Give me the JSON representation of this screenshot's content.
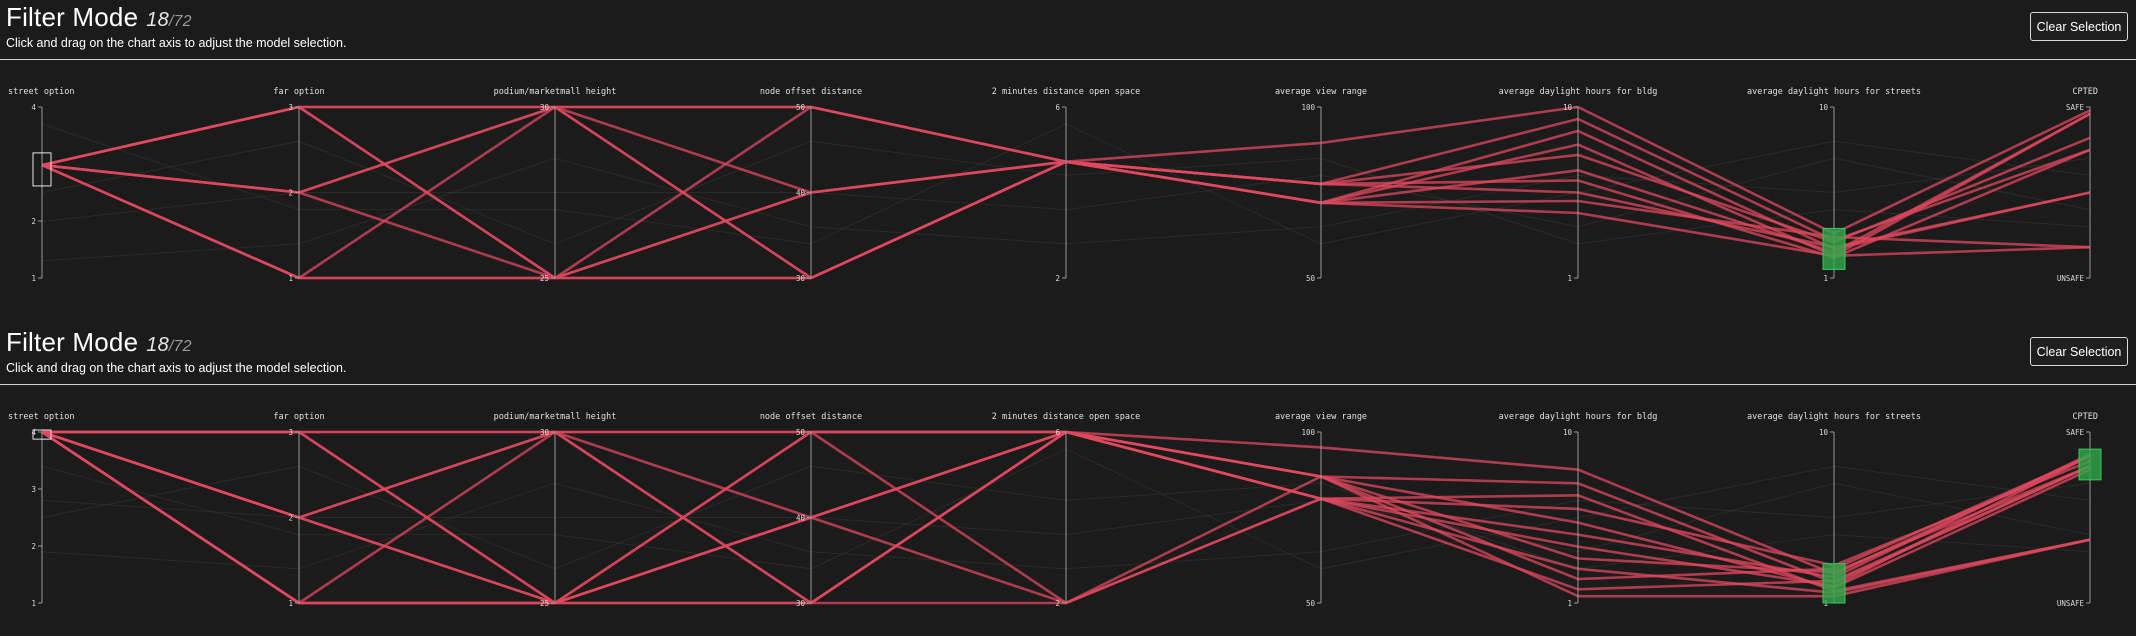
{
  "panels": [
    {
      "title": "Filter Mode",
      "count": "18",
      "total": "/72",
      "hint": "Click and drag on the chart axis to adjust the model selection.",
      "clear_label": "Clear Selection"
    },
    {
      "title": "Filter Mode",
      "count": "18",
      "total": "/72",
      "hint": "Click and drag on the chart axis to adjust the model selection.",
      "clear_label": "Clear Selection"
    }
  ],
  "colors": {
    "background": "#1b1b1b",
    "selected_line": "#e0485f",
    "context_line": "#3a3a3a",
    "brush": "#2faa4b"
  },
  "chart_data": [
    {
      "type": "parallel-coordinates",
      "axes": [
        {
          "label": "street option",
          "top": "4",
          "mid": [
            "",
            "2"
          ],
          "bottom": "1"
        },
        {
          "label": "far option",
          "top": "3",
          "mid": [
            "2"
          ],
          "bottom": "1"
        },
        {
          "label": "podium/marketmall height",
          "top": "30",
          "mid": [],
          "bottom": "25"
        },
        {
          "label": "node offset distance",
          "top": "50",
          "mid": [
            "40"
          ],
          "bottom": "30"
        },
        {
          "label": "2 minutes distance open space",
          "top": "6",
          "mid": [],
          "bottom": "2"
        },
        {
          "label": "average view range",
          "top": "100",
          "mid": [],
          "bottom": "50"
        },
        {
          "label": "average daylight hours for bldg",
          "top": "10",
          "mid": [],
          "bottom": "1"
        },
        {
          "label": "average daylight hours for streets",
          "top": "10",
          "mid": [],
          "bottom": "1"
        },
        {
          "label": "CPTED",
          "top": "SAFE",
          "mid": [],
          "bottom": "UNSAFE"
        }
      ],
      "lines": [
        [
          0.66,
          1.0,
          1.0,
          1.0,
          0.68,
          0.79,
          1.0,
          0.26,
          0.98
        ],
        [
          0.66,
          1.0,
          1.0,
          0.5,
          0.68,
          0.55,
          0.93,
          0.22,
          0.75
        ],
        [
          0.66,
          0.5,
          0.0,
          0.0,
          0.68,
          0.44,
          0.86,
          0.17,
          0.5
        ],
        [
          0.66,
          0.0,
          0.0,
          0.5,
          0.68,
          0.44,
          0.78,
          0.13,
          0.18
        ],
        [
          0.66,
          0.5,
          1.0,
          0.0,
          0.68,
          0.55,
          0.72,
          0.21,
          0.82
        ],
        [
          0.66,
          1.0,
          0.0,
          1.0,
          0.68,
          0.44,
          0.63,
          0.15,
          0.96
        ],
        [
          0.66,
          0.0,
          1.0,
          0.0,
          0.68,
          0.55,
          0.57,
          0.12,
          0.75
        ],
        [
          0.66,
          0.5,
          1.0,
          1.0,
          0.68,
          0.55,
          0.5,
          0.18,
          0.5
        ],
        [
          0.66,
          0.0,
          0.0,
          0.0,
          0.68,
          0.44,
          0.45,
          0.24,
          0.18
        ],
        [
          0.66,
          1.0,
          0.0,
          0.5,
          0.68,
          0.44,
          0.38,
          0.13,
          0.96
        ]
      ],
      "context_lines": [
        [
          0.33,
          0.5,
          0.5,
          0.5,
          0.4,
          0.6,
          0.3,
          0.7,
          0.4
        ],
        [
          0.1,
          0.2,
          0.7,
          0.3,
          0.2,
          0.3,
          0.6,
          0.5,
          0.7
        ],
        [
          0.5,
          0.8,
          0.2,
          0.8,
          0.6,
          0.7,
          0.2,
          0.4,
          0.3
        ],
        [
          0.9,
          0.4,
          0.4,
          0.2,
          0.9,
          0.2,
          0.5,
          0.8,
          0.6
        ]
      ],
      "brushes": [
        {
          "axis": 0,
          "range": [
            0.55,
            0.72
          ],
          "style": "outline"
        },
        {
          "axis": 7,
          "range": [
            0.05,
            0.29
          ],
          "style": "filled"
        }
      ]
    },
    {
      "type": "parallel-coordinates",
      "axes": [
        {
          "label": "street option",
          "top": "4",
          "mid": [
            "3",
            "2"
          ],
          "bottom": "1"
        },
        {
          "label": "far option",
          "top": "3",
          "mid": [
            "2"
          ],
          "bottom": "1"
        },
        {
          "label": "podium/marketmall height",
          "top": "30",
          "mid": [],
          "bottom": "25"
        },
        {
          "label": "node offset distance",
          "top": "50",
          "mid": [
            "40"
          ],
          "bottom": "30"
        },
        {
          "label": "2 minutes distance open space",
          "top": "6",
          "mid": [],
          "bottom": "2"
        },
        {
          "label": "average view range",
          "top": "100",
          "mid": [],
          "bottom": "50"
        },
        {
          "label": "average daylight hours for bldg",
          "top": "10",
          "mid": [],
          "bottom": "1"
        },
        {
          "label": "average daylight hours for streets",
          "top": "10",
          "mid": [],
          "bottom": "1"
        },
        {
          "label": "CPTED",
          "top": "SAFE",
          "mid": [],
          "bottom": "UNSAFE"
        }
      ],
      "lines": [
        [
          1.0,
          1.0,
          1.0,
          1.0,
          1.0,
          0.91,
          0.78,
          0.17,
          0.86
        ],
        [
          1.0,
          0.5,
          0.0,
          0.5,
          1.0,
          0.74,
          0.7,
          0.12,
          0.8
        ],
        [
          1.0,
          0.0,
          0.0,
          0.0,
          1.0,
          0.61,
          0.63,
          0.07,
          0.37
        ],
        [
          1.0,
          1.0,
          0.0,
          0.5,
          1.0,
          0.61,
          0.55,
          0.22,
          0.83
        ],
        [
          1.0,
          0.5,
          1.0,
          0.0,
          1.0,
          0.74,
          0.47,
          0.09,
          0.78
        ],
        [
          1.0,
          0.0,
          1.0,
          1.0,
          1.0,
          0.61,
          0.4,
          0.15,
          0.87
        ],
        [
          1.0,
          1.0,
          0.0,
          0.0,
          0.0,
          0.61,
          0.33,
          0.1,
          0.86
        ],
        [
          1.0,
          0.5,
          1.0,
          0.5,
          0.0,
          0.74,
          0.26,
          0.18,
          0.8
        ],
        [
          1.0,
          0.0,
          0.0,
          1.0,
          0.0,
          0.61,
          0.2,
          0.06,
          0.37
        ],
        [
          1.0,
          1.0,
          1.0,
          0.0,
          1.0,
          0.74,
          0.14,
          0.2,
          0.86
        ],
        [
          1.0,
          0.0,
          0.0,
          0.5,
          1.0,
          0.61,
          0.08,
          0.13,
          0.8
        ],
        [
          1.0,
          0.5,
          0.0,
          1.0,
          1.0,
          0.74,
          0.04,
          0.04,
          0.37
        ]
      ],
      "context_lines": [
        [
          0.6,
          0.5,
          0.5,
          0.5,
          0.4,
          0.6,
          0.3,
          0.7,
          0.4
        ],
        [
          0.3,
          0.2,
          0.7,
          0.3,
          0.2,
          0.3,
          0.6,
          0.5,
          0.7
        ],
        [
          0.5,
          0.8,
          0.2,
          0.8,
          0.6,
          0.7,
          0.2,
          0.4,
          0.3
        ],
        [
          0.8,
          0.4,
          0.4,
          0.2,
          0.9,
          0.2,
          0.5,
          0.8,
          0.6
        ]
      ],
      "brushes": [
        {
          "axis": 0,
          "range": [
            0.97,
            1.0
          ],
          "style": "outline"
        },
        {
          "axis": 7,
          "range": [
            0.0,
            0.23
          ],
          "style": "filled"
        },
        {
          "axis": 8,
          "range": [
            0.72,
            0.9
          ],
          "style": "filled"
        }
      ]
    }
  ]
}
